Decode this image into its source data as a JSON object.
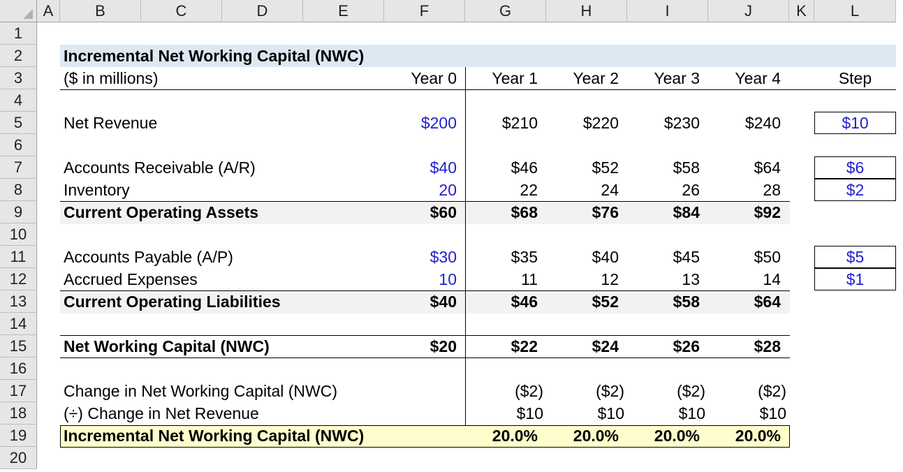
{
  "sheet": {
    "col_headers": [
      "A",
      "B",
      "C",
      "D",
      "E",
      "F",
      "G",
      "H",
      "I",
      "J",
      "K",
      "L"
    ],
    "row_headers": [
      "1",
      "2",
      "3",
      "4",
      "5",
      "6",
      "7",
      "8",
      "9",
      "10",
      "11",
      "12",
      "13",
      "14",
      "15",
      "16",
      "17",
      "18",
      "19",
      "20"
    ]
  },
  "table": {
    "title": "Incremental Net Working Capital (NWC)",
    "units": "($ in millions)",
    "years": [
      "Year 0",
      "Year 1",
      "Year 2",
      "Year 3",
      "Year 4"
    ],
    "step_header": "Step",
    "rows": {
      "net_revenue": {
        "label": "Net Revenue",
        "values": [
          "$200",
          "$210",
          "$220",
          "$230",
          "$240"
        ],
        "step": "$10"
      },
      "ar": {
        "label": "Accounts Receivable (A/R)",
        "values": [
          "$40",
          "$46",
          "$52",
          "$58",
          "$64"
        ],
        "step": "$6"
      },
      "inventory": {
        "label": "Inventory",
        "values": [
          "20",
          "22",
          "24",
          "26",
          "28"
        ],
        "step": "$2"
      },
      "coa": {
        "label": "Current Operating Assets",
        "values": [
          "$60",
          "$68",
          "$76",
          "$84",
          "$92"
        ]
      },
      "ap": {
        "label": "Accounts Payable (A/P)",
        "values": [
          "$30",
          "$35",
          "$40",
          "$45",
          "$50"
        ],
        "step": "$5"
      },
      "accrued": {
        "label": "Accrued Expenses",
        "values": [
          "10",
          "11",
          "12",
          "13",
          "14"
        ],
        "step": "$1"
      },
      "col": {
        "label": "Current Operating Liabilities",
        "values": [
          "$40",
          "$46",
          "$52",
          "$58",
          "$64"
        ]
      },
      "nwc": {
        "label": "Net Working Capital (NWC)",
        "values": [
          "$20",
          "$22",
          "$24",
          "$26",
          "$28"
        ]
      },
      "change_nwc": {
        "label": "Change in Net Working Capital (NWC)",
        "values": [
          "",
          "($2)",
          "($2)",
          "($2)",
          "($2)"
        ]
      },
      "change_rev": {
        "label": "(÷) Change in Net Revenue",
        "values": [
          "",
          "$10",
          "$10",
          "$10",
          "$10"
        ]
      },
      "incremental": {
        "label": "Incremental Net Working Capital (NWC)",
        "values": [
          "",
          "20.0%",
          "20.0%",
          "20.0%",
          "20.0%"
        ]
      }
    }
  },
  "colors": {
    "header_band": "#dde8f3",
    "subtotal_band": "#f2f2f2",
    "highlight_band": "#fefdcc",
    "input_blue": "#1f1fcc"
  }
}
